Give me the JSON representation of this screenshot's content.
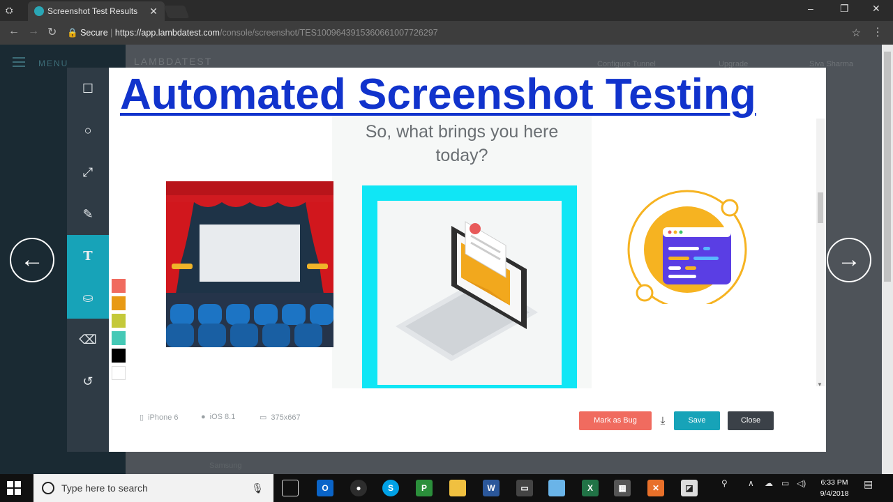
{
  "browser": {
    "tab_title": "Screenshot Test Results",
    "tab_close": "✕",
    "secure_label": "Secure",
    "url_host": "https://app.lambdatest.com",
    "url_path": "/console/screenshot/TES1009643915360661007726297",
    "window_min": "–",
    "window_restore": "❐",
    "window_close": "✕"
  },
  "app": {
    "menu_label": "MENU",
    "logo_text": "LAMBDATEST",
    "tunnel_label": "Configure Tunnel",
    "upgrade_label": "Upgrade",
    "user_name": "Siva Sharma",
    "device_row_label": "Samsung"
  },
  "headline": "Automated Screenshot Testing",
  "screen": {
    "question": "So, what brings you here today?"
  },
  "toolbar": {
    "tools": [
      {
        "name": "rectangle",
        "glyph": "☐"
      },
      {
        "name": "circle",
        "glyph": "○"
      },
      {
        "name": "arrow",
        "glyph": "⤢"
      },
      {
        "name": "pencil",
        "glyph": "✎"
      },
      {
        "name": "text",
        "glyph": "T"
      },
      {
        "name": "fill",
        "glyph": "⛀"
      },
      {
        "name": "eraser",
        "glyph": "⌫"
      },
      {
        "name": "undo",
        "glyph": "↺"
      }
    ],
    "active_tool": "fill"
  },
  "palette": {
    "colors": [
      "#f06b5f",
      "#e89a14",
      "#c4c93a",
      "#45c9b6",
      "#000000",
      "#ffffff"
    ]
  },
  "device_info": {
    "device": "iPhone 6",
    "os": "iOS 8.1",
    "resolution": "375x667"
  },
  "actions": {
    "mark_bug": "Mark as Bug",
    "download_glyph": "⤓",
    "save": "Save",
    "close": "Close"
  },
  "colors": {
    "accent": "#17a3b8",
    "bug": "#f06b5f",
    "close_btn": "#3b4148",
    "highlight": "#10e6f5",
    "headline": "#1133cc"
  },
  "nav": {
    "prev_glyph": "←",
    "next_glyph": "→"
  },
  "taskbar": {
    "search_placeholder": "Type here to search",
    "time": "6:33 PM",
    "date": "9/4/2018"
  }
}
